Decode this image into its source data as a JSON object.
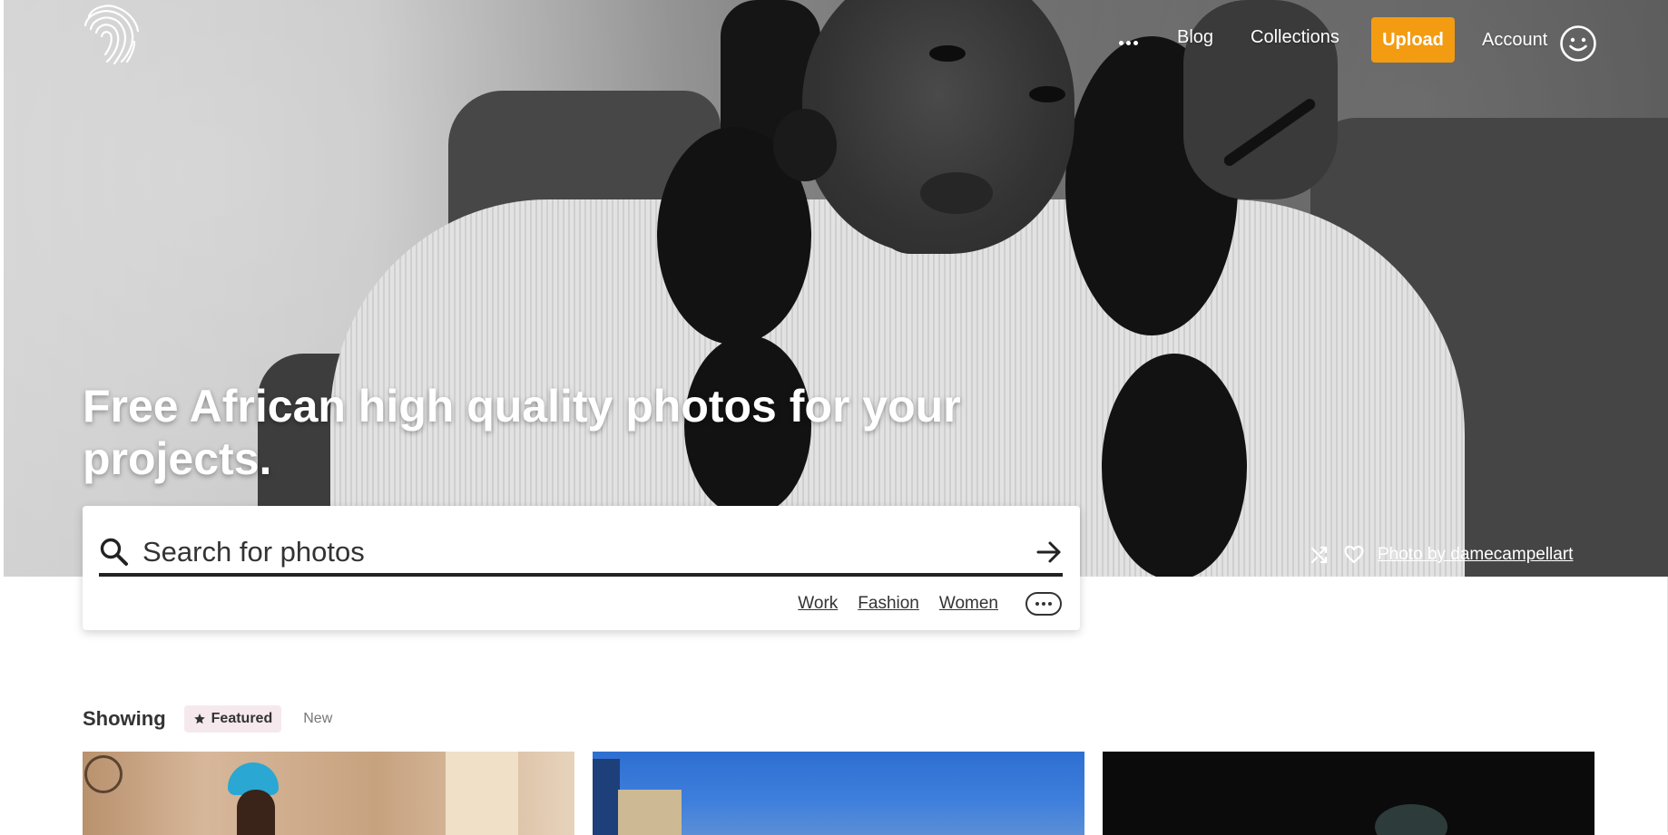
{
  "nav": {
    "more_icon": "more-horizontal-icon",
    "blog": "Blog",
    "collections": "Collections",
    "upload": "Upload",
    "account": "Account",
    "account_icon": "smiley-face-icon"
  },
  "hero": {
    "headline": "Free African high quality photos for your projects.",
    "credit": {
      "shuffle_icon": "shuffle-icon",
      "like_icon": "heart-icon",
      "text": "Photo by damecampellart"
    }
  },
  "search": {
    "placeholder": "Search for photos",
    "value": "",
    "suggestions": [
      "Work",
      "Fashion",
      "Women"
    ],
    "more_icon": "more-horizontal-icon"
  },
  "showing": {
    "label": "Showing",
    "filters": {
      "featured": "Featured",
      "new": "New"
    },
    "active": "featured"
  },
  "colors": {
    "accent": "#f39c12",
    "featured_bg": "#f6e9ee",
    "text": "#333333"
  }
}
